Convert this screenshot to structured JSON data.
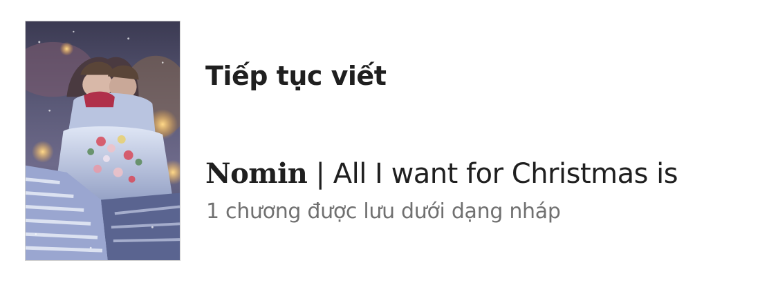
{
  "section": {
    "title": "Tiếp tục viết"
  },
  "story": {
    "title_name": "Nomin",
    "title_rest": " | All I want for Christmas is",
    "subtitle": "1 chương được lưu dưới dạng nháp"
  }
}
